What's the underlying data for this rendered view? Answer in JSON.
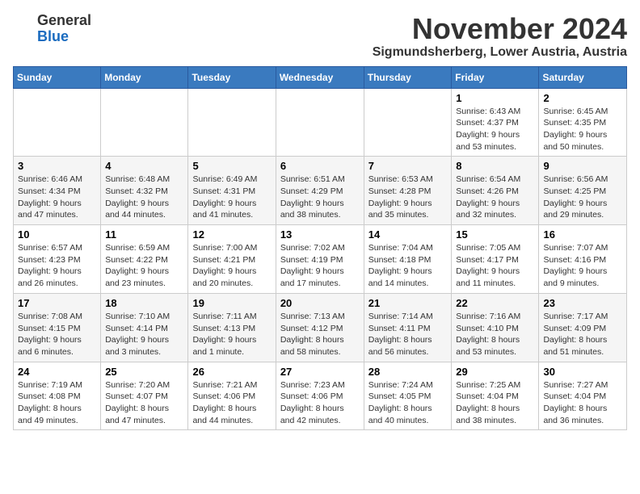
{
  "logo": {
    "general": "General",
    "blue": "Blue"
  },
  "header": {
    "month": "November 2024",
    "location": "Sigmundsherberg, Lower Austria, Austria"
  },
  "weekdays": [
    "Sunday",
    "Monday",
    "Tuesday",
    "Wednesday",
    "Thursday",
    "Friday",
    "Saturday"
  ],
  "weeks": [
    [
      {
        "day": null,
        "info": null
      },
      {
        "day": null,
        "info": null
      },
      {
        "day": null,
        "info": null
      },
      {
        "day": null,
        "info": null
      },
      {
        "day": null,
        "info": null
      },
      {
        "day": "1",
        "info": "Sunrise: 6:43 AM\nSunset: 4:37 PM\nDaylight: 9 hours\nand 53 minutes."
      },
      {
        "day": "2",
        "info": "Sunrise: 6:45 AM\nSunset: 4:35 PM\nDaylight: 9 hours\nand 50 minutes."
      }
    ],
    [
      {
        "day": "3",
        "info": "Sunrise: 6:46 AM\nSunset: 4:34 PM\nDaylight: 9 hours\nand 47 minutes."
      },
      {
        "day": "4",
        "info": "Sunrise: 6:48 AM\nSunset: 4:32 PM\nDaylight: 9 hours\nand 44 minutes."
      },
      {
        "day": "5",
        "info": "Sunrise: 6:49 AM\nSunset: 4:31 PM\nDaylight: 9 hours\nand 41 minutes."
      },
      {
        "day": "6",
        "info": "Sunrise: 6:51 AM\nSunset: 4:29 PM\nDaylight: 9 hours\nand 38 minutes."
      },
      {
        "day": "7",
        "info": "Sunrise: 6:53 AM\nSunset: 4:28 PM\nDaylight: 9 hours\nand 35 minutes."
      },
      {
        "day": "8",
        "info": "Sunrise: 6:54 AM\nSunset: 4:26 PM\nDaylight: 9 hours\nand 32 minutes."
      },
      {
        "day": "9",
        "info": "Sunrise: 6:56 AM\nSunset: 4:25 PM\nDaylight: 9 hours\nand 29 minutes."
      }
    ],
    [
      {
        "day": "10",
        "info": "Sunrise: 6:57 AM\nSunset: 4:23 PM\nDaylight: 9 hours\nand 26 minutes."
      },
      {
        "day": "11",
        "info": "Sunrise: 6:59 AM\nSunset: 4:22 PM\nDaylight: 9 hours\nand 23 minutes."
      },
      {
        "day": "12",
        "info": "Sunrise: 7:00 AM\nSunset: 4:21 PM\nDaylight: 9 hours\nand 20 minutes."
      },
      {
        "day": "13",
        "info": "Sunrise: 7:02 AM\nSunset: 4:19 PM\nDaylight: 9 hours\nand 17 minutes."
      },
      {
        "day": "14",
        "info": "Sunrise: 7:04 AM\nSunset: 4:18 PM\nDaylight: 9 hours\nand 14 minutes."
      },
      {
        "day": "15",
        "info": "Sunrise: 7:05 AM\nSunset: 4:17 PM\nDaylight: 9 hours\nand 11 minutes."
      },
      {
        "day": "16",
        "info": "Sunrise: 7:07 AM\nSunset: 4:16 PM\nDaylight: 9 hours\nand 9 minutes."
      }
    ],
    [
      {
        "day": "17",
        "info": "Sunrise: 7:08 AM\nSunset: 4:15 PM\nDaylight: 9 hours\nand 6 minutes."
      },
      {
        "day": "18",
        "info": "Sunrise: 7:10 AM\nSunset: 4:14 PM\nDaylight: 9 hours\nand 3 minutes."
      },
      {
        "day": "19",
        "info": "Sunrise: 7:11 AM\nSunset: 4:13 PM\nDaylight: 9 hours\nand 1 minute."
      },
      {
        "day": "20",
        "info": "Sunrise: 7:13 AM\nSunset: 4:12 PM\nDaylight: 8 hours\nand 58 minutes."
      },
      {
        "day": "21",
        "info": "Sunrise: 7:14 AM\nSunset: 4:11 PM\nDaylight: 8 hours\nand 56 minutes."
      },
      {
        "day": "22",
        "info": "Sunrise: 7:16 AM\nSunset: 4:10 PM\nDaylight: 8 hours\nand 53 minutes."
      },
      {
        "day": "23",
        "info": "Sunrise: 7:17 AM\nSunset: 4:09 PM\nDaylight: 8 hours\nand 51 minutes."
      }
    ],
    [
      {
        "day": "24",
        "info": "Sunrise: 7:19 AM\nSunset: 4:08 PM\nDaylight: 8 hours\nand 49 minutes."
      },
      {
        "day": "25",
        "info": "Sunrise: 7:20 AM\nSunset: 4:07 PM\nDaylight: 8 hours\nand 47 minutes."
      },
      {
        "day": "26",
        "info": "Sunrise: 7:21 AM\nSunset: 4:06 PM\nDaylight: 8 hours\nand 44 minutes."
      },
      {
        "day": "27",
        "info": "Sunrise: 7:23 AM\nSunset: 4:06 PM\nDaylight: 8 hours\nand 42 minutes."
      },
      {
        "day": "28",
        "info": "Sunrise: 7:24 AM\nSunset: 4:05 PM\nDaylight: 8 hours\nand 40 minutes."
      },
      {
        "day": "29",
        "info": "Sunrise: 7:25 AM\nSunset: 4:04 PM\nDaylight: 8 hours\nand 38 minutes."
      },
      {
        "day": "30",
        "info": "Sunrise: 7:27 AM\nSunset: 4:04 PM\nDaylight: 8 hours\nand 36 minutes."
      }
    ]
  ]
}
